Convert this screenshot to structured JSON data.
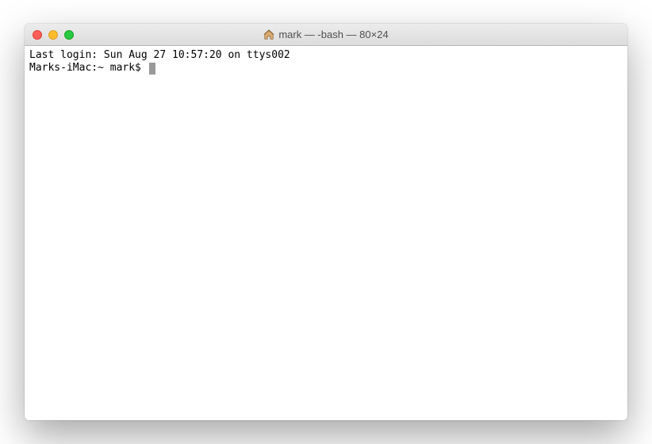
{
  "window": {
    "title": "mark — -bash — 80×24"
  },
  "terminal": {
    "last_login": "Last login: Sun Aug 27 10:57:20 on ttys002",
    "prompt": "Marks-iMac:~ mark$ "
  }
}
